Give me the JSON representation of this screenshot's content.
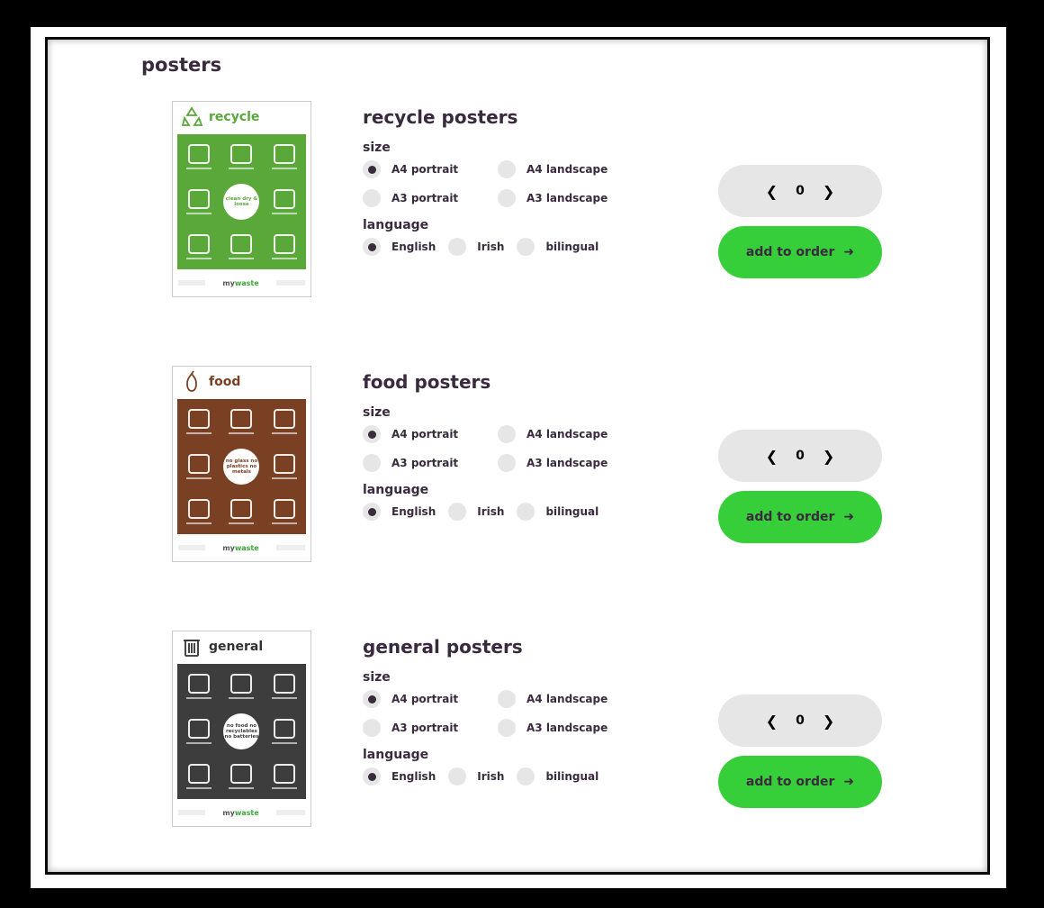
{
  "page": {
    "title": "posters"
  },
  "size_label": "size",
  "language_label": "language",
  "add_label": "add to order",
  "sections": [
    {
      "poster_title": "recycle",
      "poster_color": "#5aa83a",
      "poster_icon": "recycle-icon",
      "center_text": "clean dry & loose",
      "title": "recycle posters",
      "sizes": [
        {
          "label": "A4 portrait",
          "selected": true
        },
        {
          "label": "A4 landscape",
          "selected": false
        },
        {
          "label": "A3 portrait",
          "selected": false
        },
        {
          "label": "A3 landscape",
          "selected": false
        }
      ],
      "languages": [
        {
          "label": "English",
          "selected": true
        },
        {
          "label": "Irish",
          "selected": false
        },
        {
          "label": "bilingual",
          "selected": false
        }
      ],
      "quantity": "0"
    },
    {
      "poster_title": "food",
      "poster_color": "#7a4024",
      "poster_icon": "pear-icon",
      "center_text": "no glass no plastics no metals",
      "title": "food posters",
      "sizes": [
        {
          "label": "A4 portrait",
          "selected": true
        },
        {
          "label": "A4 landscape",
          "selected": false
        },
        {
          "label": "A3 portrait",
          "selected": false
        },
        {
          "label": "A3 landscape",
          "selected": false
        }
      ],
      "languages": [
        {
          "label": "English",
          "selected": true
        },
        {
          "label": "Irish",
          "selected": false
        },
        {
          "label": "bilingual",
          "selected": false
        }
      ],
      "quantity": "0"
    },
    {
      "poster_title": "general",
      "poster_color": "#3d3d3d",
      "poster_icon": "bin-icon",
      "center_text": "no food no recyclables no batteries",
      "title": "general posters",
      "sizes": [
        {
          "label": "A4 portrait",
          "selected": true
        },
        {
          "label": "A4 landscape",
          "selected": false
        },
        {
          "label": "A3 portrait",
          "selected": false
        },
        {
          "label": "A3 landscape",
          "selected": false
        }
      ],
      "languages": [
        {
          "label": "English",
          "selected": true
        },
        {
          "label": "Irish",
          "selected": false
        },
        {
          "label": "bilingual",
          "selected": false
        }
      ],
      "quantity": "0"
    }
  ]
}
